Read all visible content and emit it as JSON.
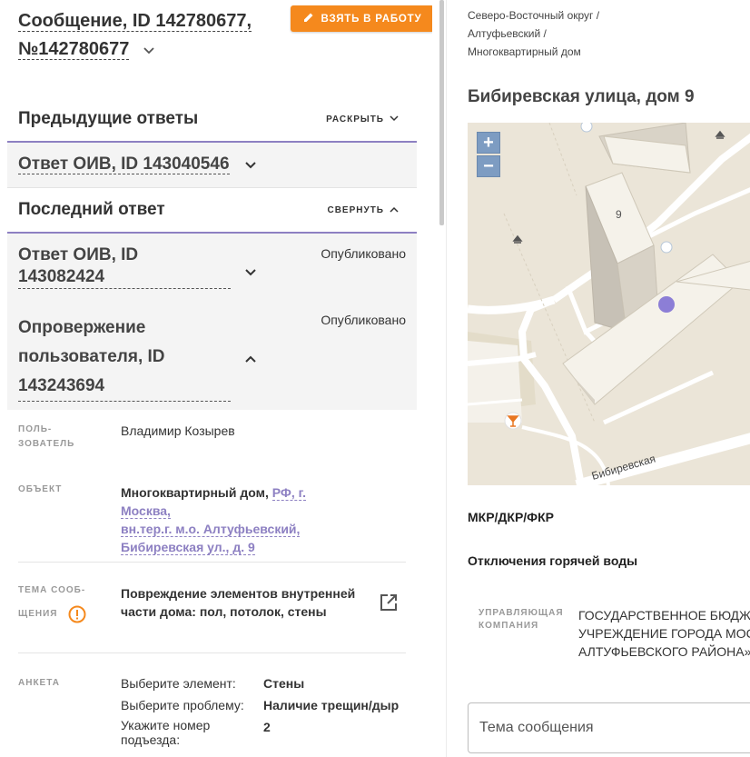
{
  "header": {
    "title_line1": "Сообщение, ID 142780677,",
    "title_line2": "№142780677",
    "take_button": "ВЗЯТЬ В РАБОТУ"
  },
  "previous": {
    "title": "Предыдущие ответы",
    "toggle": "РАСКРЫТЬ",
    "answer_title": "Ответ ОИВ, ID 143040546"
  },
  "last": {
    "title": "Последний ответ",
    "toggle": "СВЕРНУТЬ",
    "answer_line1": "Ответ ОИВ, ID",
    "answer_line2": "143082424",
    "answer_status": "Опубликовано",
    "refute_line1": "Опровержение",
    "refute_line2": "пользователя, ID",
    "refute_line3": "143243694",
    "refute_status": "Опубликовано"
  },
  "fields": {
    "user_label_1": "ПОЛЬ-",
    "user_label_2": "ЗОВАТЕЛЬ",
    "user_value": "Владимир Козырев",
    "object_label": "ОБЪЕКТ",
    "object_prefix": "Многоквартирный дом,",
    "object_link1": "РФ, г. Москва,",
    "object_link2": "вн.тер.г. м.о. Алтуфьевский,",
    "object_link3": "Бибиревская ул., д. 9",
    "topic_label_1": "ТЕМА СООБ-",
    "topic_label_2": "ЩЕНИЯ",
    "topic_value_1": "Повреждение элементов внутренней",
    "topic_value_2": "части дома: пол, потолок, стены",
    "survey_label": "АНКЕТА",
    "survey": [
      {
        "q": "Выберите элемент:",
        "a": "Стены"
      },
      {
        "q": "Выберите проблему:",
        "a": "Наличие трещин/дыр"
      },
      {
        "q": "Укажите номер",
        "q2": "подъезда:",
        "a": "2"
      }
    ]
  },
  "right": {
    "crumb1": "Северо-Восточный округ /",
    "crumb2": "Алтуфьевский /",
    "crumb3": "Многоквартирный дом",
    "address": "Бибиревская улица, дом 9",
    "map_street": "Бибиревская",
    "map_house": "9",
    "zoom_in": "+",
    "zoom_out": "−",
    "mkr": "МКР/ДКР/ФКР",
    "hot_water": "Отключения горячей воды",
    "mgr_label_1": "УПРАВЛЯЮЩАЯ",
    "mgr_label_2": "КОМПАНИЯ",
    "mgr_value_1": "ГОСУДАРСТВЕННОЕ БЮДЖЕТНОЕ",
    "mgr_value_2": "УЧРЕЖДЕНИЕ ГОРОДА МОСКВЫ",
    "mgr_value_3": "АЛТУФЬЕВСКОГО РАЙОНА»",
    "topic_placeholder": "Тема сообщения"
  },
  "colors": {
    "accent_orange": "#f5891d",
    "accent_purple": "#8d80c2",
    "map_marker": "#8c7ed6"
  }
}
